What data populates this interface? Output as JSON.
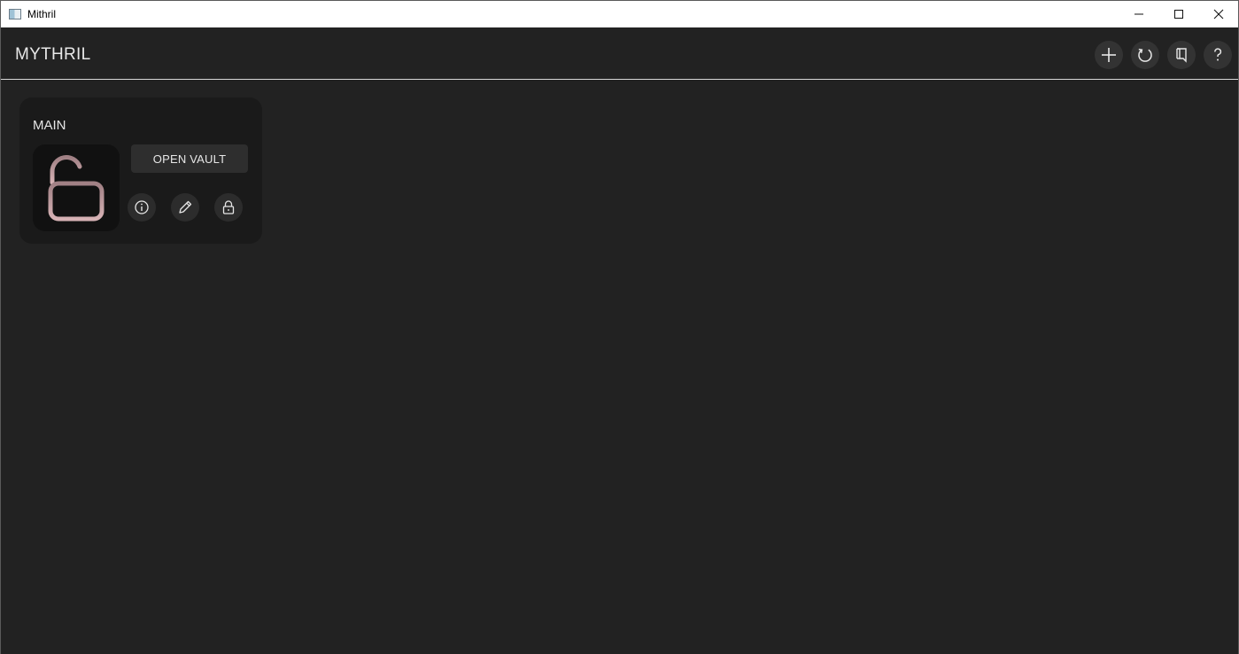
{
  "window": {
    "title": "Mithril",
    "controls": [
      {
        "name": "minimize",
        "icon": "minimize-icon"
      },
      {
        "name": "maximize",
        "icon": "maximize-icon"
      },
      {
        "name": "close",
        "icon": "close-icon"
      }
    ]
  },
  "header": {
    "title": "MYTHRIL",
    "actions": [
      {
        "name": "add-vault",
        "icon": "plus-icon"
      },
      {
        "name": "refresh",
        "icon": "refresh-icon"
      },
      {
        "name": "bookmark",
        "icon": "bookmark-icon"
      },
      {
        "name": "help",
        "icon": "question-icon"
      }
    ]
  },
  "vaults": [
    {
      "name": "MAIN",
      "status": "unlocked",
      "status_icon": "unlocked-padlock-icon",
      "open_label": "OPEN VAULT",
      "actions": [
        {
          "name": "info",
          "icon": "info-icon"
        },
        {
          "name": "edit",
          "icon": "pencil-icon"
        },
        {
          "name": "lock",
          "icon": "lock-icon"
        }
      ]
    }
  ],
  "colors": {
    "background": "#222222",
    "card": "#1a1a1a",
    "accent_lock": "#c9a3a6",
    "text": "#e6e6e6"
  }
}
